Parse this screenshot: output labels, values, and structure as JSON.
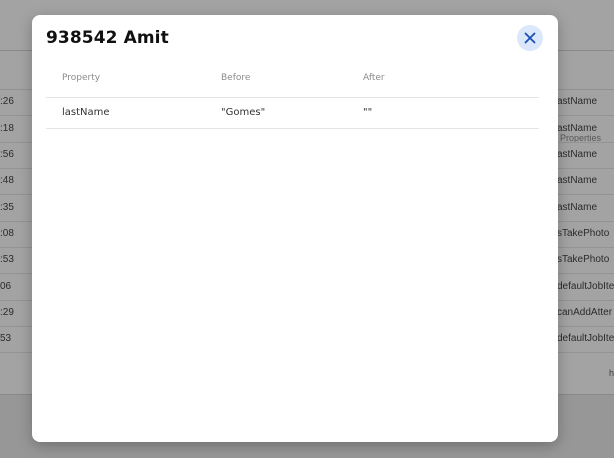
{
  "background": {
    "header_right": "Properties",
    "rows": [
      {
        "time": ":26",
        "prop": "astName"
      },
      {
        "time": ":18",
        "prop": "astName"
      },
      {
        "time": ":56",
        "prop": "astName"
      },
      {
        "time": ":48",
        "prop": "astName"
      },
      {
        "time": ":35",
        "prop": "astName"
      },
      {
        "time": ":08",
        "prop": "sTakePhoto"
      },
      {
        "time": ":53",
        "prop": "sTakePhoto"
      },
      {
        "time": "06",
        "prop": "defaultJobIte"
      },
      {
        "time": ":29",
        "prop": "canAddAtter"
      },
      {
        "time": "53",
        "prop": "defaultJobIte"
      }
    ],
    "footer_text": "h"
  },
  "modal": {
    "title": "938542 Amit",
    "close_icon": "close-icon",
    "columns": [
      "Property",
      "Before",
      "After"
    ],
    "rows": [
      {
        "property": "lastName",
        "before": "\"Gomes\"",
        "after": "\"\""
      }
    ]
  },
  "colors": {
    "overlay": "rgba(0,0,0,0.36)",
    "close_button_bg": "#dbe8fb",
    "close_icon": "#1a4fb5"
  }
}
